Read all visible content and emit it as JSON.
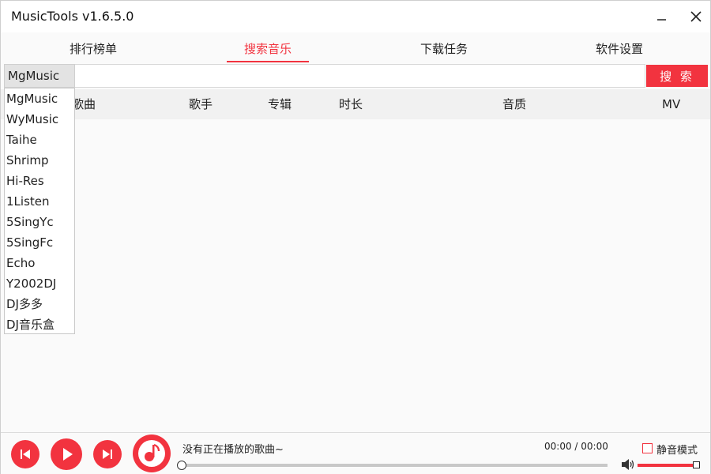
{
  "window": {
    "title": "MusicTools v1.6.5.0",
    "accent_color": "#f2333f"
  },
  "tabs": [
    {
      "label": "排行榜单",
      "active": false
    },
    {
      "label": "搜索音乐",
      "active": true
    },
    {
      "label": "下载任务",
      "active": false
    },
    {
      "label": "软件设置",
      "active": false
    }
  ],
  "search": {
    "source_selected": "MgMusic",
    "query": "",
    "button_label": "搜 索"
  },
  "source_options": [
    "MgMusic",
    "WyMusic",
    "Taihe",
    "Shrimp",
    "Hi-Res",
    "1Listen",
    "5SingYc",
    "5SingFc",
    "Echo",
    "Y2002DJ",
    "DJ多多",
    "DJ音乐盒"
  ],
  "table": {
    "columns": [
      "歌曲",
      "歌手",
      "专辑",
      "时长",
      "音质",
      "MV"
    ]
  },
  "player": {
    "now_playing": "没有正在播放的歌曲~",
    "time": "00:00 / 00:00",
    "progress": 0,
    "volume": 1.0,
    "mute_label": "静音模式",
    "mute_checked": false
  }
}
